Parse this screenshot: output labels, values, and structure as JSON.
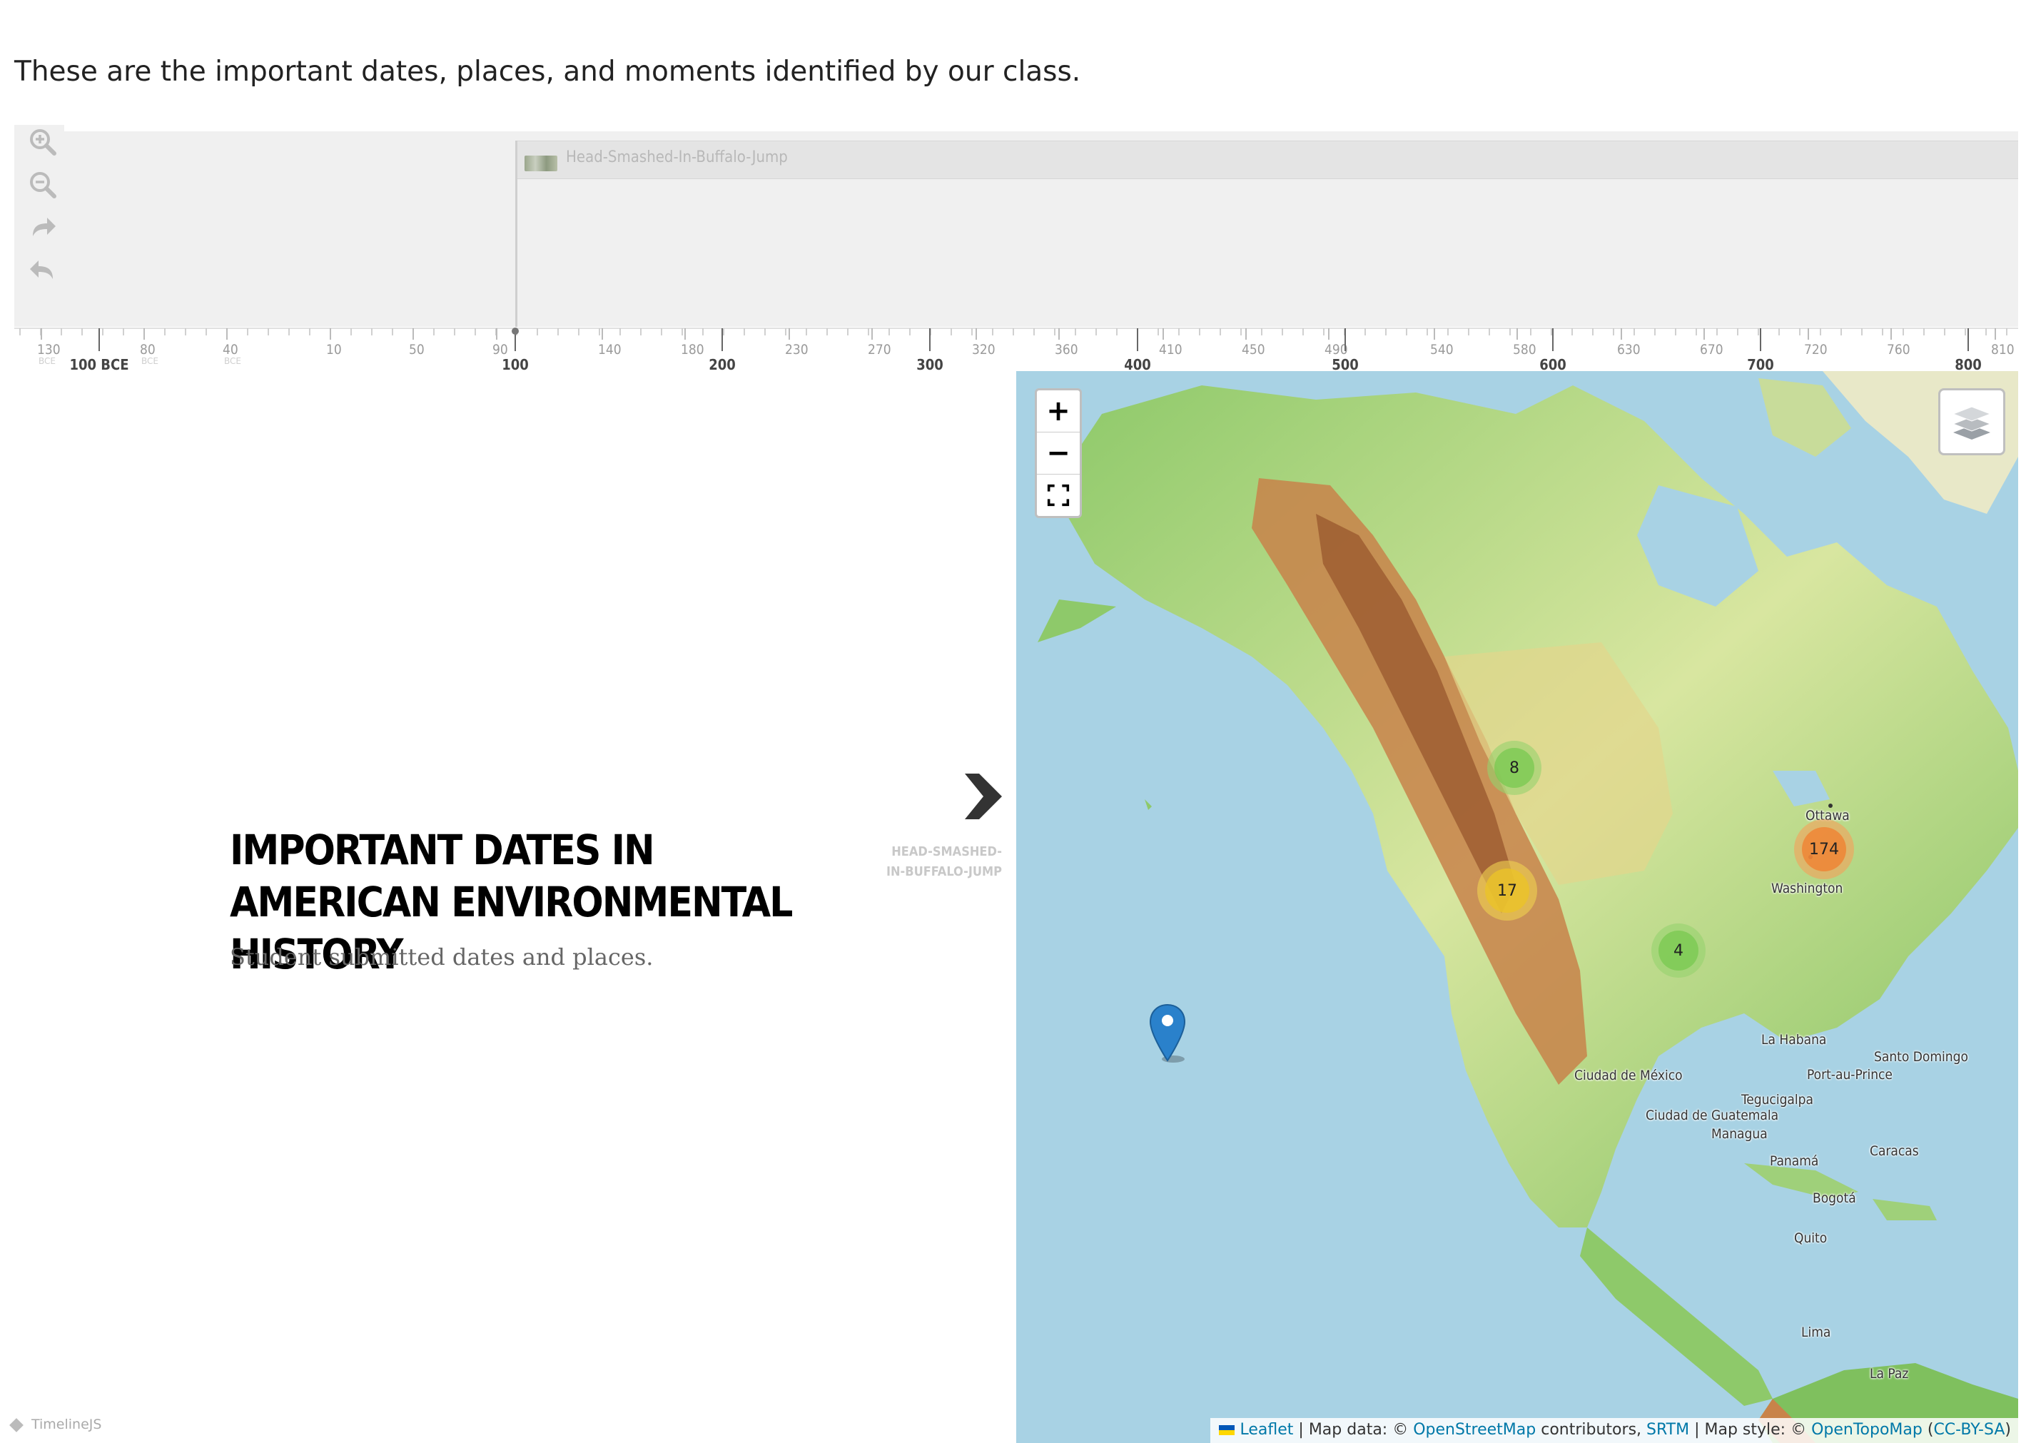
{
  "intro": "These are the important dates, places, and moments identified by our class.",
  "timeline_nav": {
    "zoom_in_icon": "zoom-in-icon",
    "zoom_out_icon": "zoom-out-icon",
    "forward_icon": "forward-arrow-icon",
    "back_icon": "back-arrow-icon",
    "marker_title": "Head-Smashed-In-Buffalo-Jump"
  },
  "axis": {
    "minor": [
      {
        "label": "130",
        "era": "BCE"
      },
      {
        "label": "80",
        "era": "BCE"
      },
      {
        "label": "40",
        "era": "BCE"
      },
      {
        "label": "10",
        "era": ""
      },
      {
        "label": "50",
        "era": ""
      },
      {
        "label": "90",
        "era": ""
      },
      {
        "label": "140",
        "era": ""
      },
      {
        "label": "180",
        "era": ""
      },
      {
        "label": "230",
        "era": ""
      },
      {
        "label": "270",
        "era": ""
      },
      {
        "label": "320",
        "era": ""
      },
      {
        "label": "360",
        "era": ""
      },
      {
        "label": "410",
        "era": ""
      },
      {
        "label": "450",
        "era": ""
      },
      {
        "label": "490",
        "era": ""
      },
      {
        "label": "540",
        "era": ""
      },
      {
        "label": "580",
        "era": ""
      },
      {
        "label": "630",
        "era": ""
      },
      {
        "label": "670",
        "era": ""
      },
      {
        "label": "720",
        "era": ""
      },
      {
        "label": "760",
        "era": ""
      },
      {
        "label": "810",
        "era": ""
      }
    ],
    "major": [
      "100 BCE",
      "100",
      "200",
      "300",
      "400",
      "500",
      "600",
      "700",
      "800"
    ]
  },
  "slide": {
    "title": "IMPORTANT DATES IN AMERICAN ENVIRONMENTAL HISTORY",
    "subtitle": "Student submitted dates and places.",
    "next_label": "HEAD-SMASHED-IN-BUFFALO-JUMP",
    "next_icon": "chevron-right-icon"
  },
  "brand": "TimelineJS",
  "map": {
    "zoom_in": "+",
    "zoom_out": "−",
    "fullscreen_icon": "fullscreen-icon",
    "layers_icon": "layers-icon",
    "marker_icon": "map-pin-icon",
    "clusters": [
      {
        "count": "8",
        "level": "green"
      },
      {
        "count": "174",
        "level": "orange"
      },
      {
        "count": "17",
        "level": "yellow"
      },
      {
        "count": "4",
        "level": "green"
      }
    ],
    "cities": [
      "Ottawa",
      "Washington",
      "La Habana",
      "Santo Domingo",
      "Port-au-Prince",
      "Ciudad de México",
      "Tegucigalpa",
      "Ciudad de Guatemala",
      "Managua",
      "Panamá",
      "Caracas",
      "Bogotá",
      "Quito",
      "Lima",
      "La Paz"
    ],
    "attribution": {
      "leaflet": "Leaflet",
      "sep1": " | Map data: © ",
      "osm": "OpenStreetMap",
      "contrib": " contributors, ",
      "srtm": "SRTM",
      "style": " | Map style: © ",
      "otm": "OpenTopoMap",
      "open": " (",
      "license": "CC-BY-SA",
      "close": ")"
    }
  }
}
